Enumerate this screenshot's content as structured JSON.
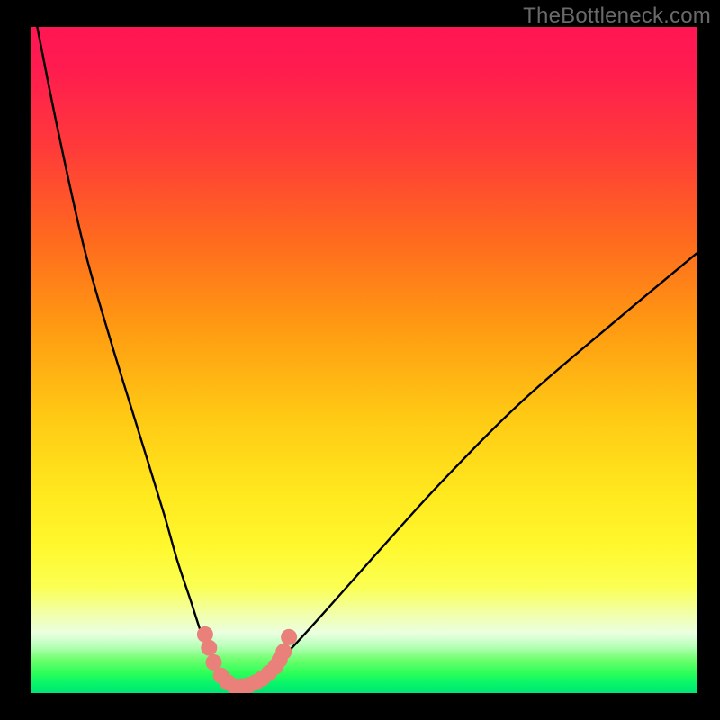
{
  "watermark": "TheBottleneck.com",
  "colors": {
    "frame": "#000000",
    "curve_stroke": "#000000",
    "marker_fill": "#e98079",
    "watermark_text": "#6a6a6a"
  },
  "chart_data": {
    "type": "line",
    "title": "",
    "xlabel": "",
    "ylabel": "",
    "xlim": [
      0,
      100
    ],
    "ylim": [
      0,
      100
    ],
    "grid": false,
    "legend": "none",
    "series": [
      {
        "name": "bottleneck-curve",
        "x": [
          1,
          4,
          8,
          12,
          16,
          20,
          22,
          24,
          26,
          28,
          29.5,
          31,
          32.5,
          34,
          38,
          44,
          52,
          62,
          74,
          88,
          100
        ],
        "y": [
          100,
          85,
          67,
          53,
          40,
          27,
          20,
          14,
          8,
          4,
          2,
          1,
          1.2,
          2,
          5.5,
          12,
          21,
          32,
          44,
          56,
          66
        ],
        "note": "Two-branch bottleneck-style curve: steep descent from top-left to a narrow minimum near x≈31, then a shallower ascent toward upper-right. Values estimated from pixels."
      }
    ],
    "markers": {
      "name": "highlighted-points",
      "color": "#e98079",
      "points": [
        {
          "x": 26.2,
          "y": 8.8
        },
        {
          "x": 26.8,
          "y": 6.8
        },
        {
          "x": 27.5,
          "y": 4.6
        },
        {
          "x": 28.6,
          "y": 2.6
        },
        {
          "x": 29.6,
          "y": 1.6
        },
        {
          "x": 30.6,
          "y": 1.0
        },
        {
          "x": 31.8,
          "y": 1.0
        },
        {
          "x": 32.8,
          "y": 1.2
        },
        {
          "x": 33.8,
          "y": 1.6
        },
        {
          "x": 34.8,
          "y": 2.2
        },
        {
          "x": 35.8,
          "y": 3.0
        },
        {
          "x": 36.8,
          "y": 4.0
        },
        {
          "x": 37.4,
          "y": 5.0
        },
        {
          "x": 38.0,
          "y": 6.2
        },
        {
          "x": 38.8,
          "y": 8.4
        }
      ]
    },
    "gradient_stops": [
      {
        "pos": 0.0,
        "color": "#ff1653"
      },
      {
        "pos": 0.18,
        "color": "#ff3a3a"
      },
      {
        "pos": 0.45,
        "color": "#ff9a12"
      },
      {
        "pos": 0.7,
        "color": "#ffe81e"
      },
      {
        "pos": 0.88,
        "color": "#f2ffa8"
      },
      {
        "pos": 0.97,
        "color": "#2dff58"
      },
      {
        "pos": 1.0,
        "color": "#00e574"
      }
    ]
  }
}
